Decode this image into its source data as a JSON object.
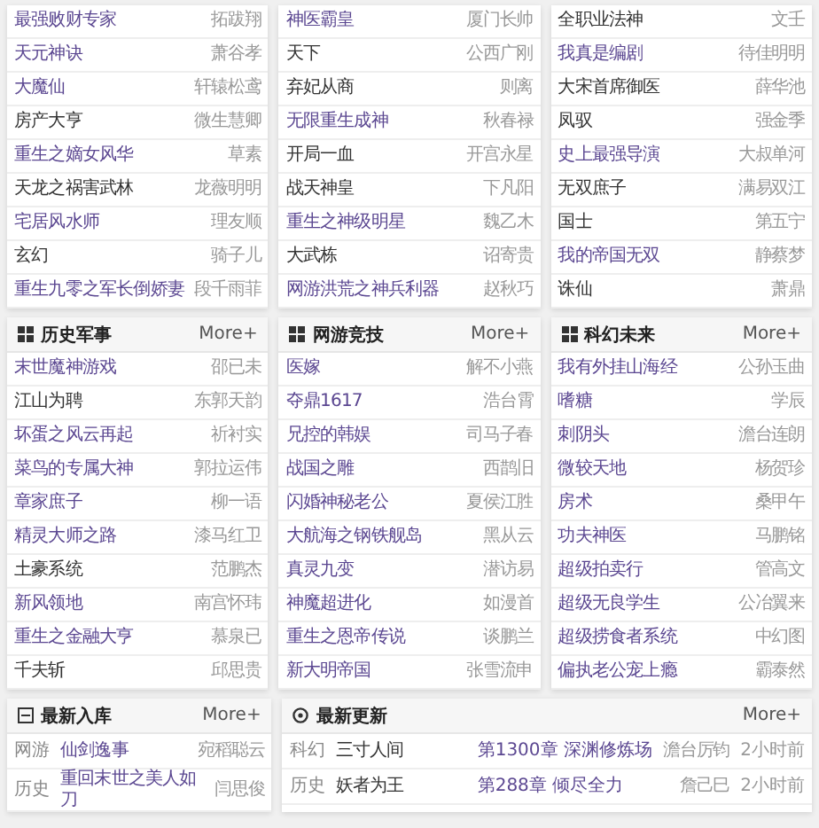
{
  "top_panels": [
    {
      "items": [
        {
          "title": "最强败财专家",
          "author": "拓跋翔",
          "visited": true
        },
        {
          "title": "天元神诀",
          "author": "萧谷孝",
          "visited": true
        },
        {
          "title": "大魔仙",
          "author": "轩辕松鸢",
          "visited": true
        },
        {
          "title": "房产大亨",
          "author": "微生慧卿",
          "visited": false
        },
        {
          "title": "重生之嫡女风华",
          "author": "草素",
          "visited": true
        },
        {
          "title": "天龙之祸害武林",
          "author": "龙薇明明",
          "visited": false
        },
        {
          "title": "宅居风水师",
          "author": "理友顺",
          "visited": true
        },
        {
          "title": "玄幻",
          "author": "骑子儿",
          "visited": false
        },
        {
          "title": "重生九零之军长倒娇妻",
          "author": "段千雨菲",
          "visited": true
        }
      ]
    },
    {
      "items": [
        {
          "title": "神医霸皇",
          "author": "厦门长帅",
          "visited": true
        },
        {
          "title": "天下",
          "author": "公西广刚",
          "visited": false
        },
        {
          "title": "弃妃从商",
          "author": "则离",
          "visited": false
        },
        {
          "title": "无限重生成神",
          "author": "秋春禄",
          "visited": true
        },
        {
          "title": "开局一血",
          "author": "开宫永星",
          "visited": false
        },
        {
          "title": "战天神皇",
          "author": "下凡阳",
          "visited": false
        },
        {
          "title": "重生之神级明星",
          "author": "魏乙木",
          "visited": true
        },
        {
          "title": "大武栋",
          "author": "诏寄贵",
          "visited": false
        },
        {
          "title": "网游洪荒之神兵利器",
          "author": "赵秋巧",
          "visited": true
        }
      ]
    },
    {
      "items": [
        {
          "title": "全职业法神",
          "author": "文壬",
          "visited": false
        },
        {
          "title": "我真是编剧",
          "author": "待佳明明",
          "visited": true
        },
        {
          "title": "大宋首席御医",
          "author": "薛华池",
          "visited": false
        },
        {
          "title": "凤驭",
          "author": "强金季",
          "visited": false
        },
        {
          "title": "史上最强导演",
          "author": "大叔单河",
          "visited": true
        },
        {
          "title": "无双庶子",
          "author": "满易双江",
          "visited": false
        },
        {
          "title": "国士",
          "author": "第五宁",
          "visited": false
        },
        {
          "title": "我的帝国无双",
          "author": "静蔡梦",
          "visited": true
        },
        {
          "title": "诛仙",
          "author": "萧鼎",
          "visited": false
        }
      ]
    }
  ],
  "category_panels": [
    {
      "title": "历史军事",
      "more": "More+",
      "items": [
        {
          "title": "末世魔神游戏",
          "author": "邵已未",
          "visited": true
        },
        {
          "title": "江山为聘",
          "author": "东郭天韵",
          "visited": false
        },
        {
          "title": "坏蛋之风云再起",
          "author": "祈衬实",
          "visited": true
        },
        {
          "title": "菜鸟的专属大神",
          "author": "郭拉运伟",
          "visited": true
        },
        {
          "title": "章家庶子",
          "author": "柳一语",
          "visited": true
        },
        {
          "title": "精灵大师之路",
          "author": "漆马红卫",
          "visited": true
        },
        {
          "title": "土豪系统",
          "author": "范鹏杰",
          "visited": false
        },
        {
          "title": "新风领地",
          "author": "南宫怀玮",
          "visited": true
        },
        {
          "title": "重生之金融大亨",
          "author": "慕泉已",
          "visited": true
        },
        {
          "title": "千夫斩",
          "author": "邱思贵",
          "visited": false
        }
      ]
    },
    {
      "title": "网游竞技",
      "more": "More+",
      "items": [
        {
          "title": "医嫁",
          "author": "解不小燕",
          "visited": true
        },
        {
          "title": "夺鼎1617",
          "author": "浩台霄",
          "visited": true
        },
        {
          "title": "兄控的韩娱",
          "author": "司马子春",
          "visited": true
        },
        {
          "title": "战国之雕",
          "author": "西鹊旧",
          "visited": true
        },
        {
          "title": "闪婚神秘老公",
          "author": "夏侯江胜",
          "visited": true
        },
        {
          "title": "大航海之钢铁舰岛",
          "author": "黑从云",
          "visited": true
        },
        {
          "title": "真灵九变",
          "author": "潜访易",
          "visited": true
        },
        {
          "title": "神魔超进化",
          "author": "如漫首",
          "visited": true
        },
        {
          "title": "重生之恩帝传说",
          "author": "谈鹏兰",
          "visited": true
        },
        {
          "title": "新大明帝国",
          "author": "张雪流申",
          "visited": true
        }
      ]
    },
    {
      "title": "科幻未来",
      "more": "More+",
      "items": [
        {
          "title": "我有外挂山海经",
          "author": "公孙玉曲",
          "visited": true
        },
        {
          "title": "嗜糖",
          "author": "学辰",
          "visited": true
        },
        {
          "title": "刺阴头",
          "author": "澹台连朗",
          "visited": true
        },
        {
          "title": "微较天地",
          "author": "杨贺珍",
          "visited": true
        },
        {
          "title": "房术",
          "author": "桑甲午",
          "visited": true
        },
        {
          "title": "功夫神医",
          "author": "马鹏铭",
          "visited": true
        },
        {
          "title": "超级拍卖行",
          "author": "管高文",
          "visited": true
        },
        {
          "title": "超级无良学生",
          "author": "公冶翼来",
          "visited": true
        },
        {
          "title": "超级捞食者系统",
          "author": "中幻图",
          "visited": true
        },
        {
          "title": "偏执老公宠上瘾",
          "author": "霸泰然",
          "visited": true
        }
      ]
    }
  ],
  "latest_added": {
    "title": "最新入库",
    "more": "More+",
    "rows": [
      {
        "category": "网游",
        "title": "仙剑逸事",
        "author": "宛稻聪云",
        "visited": true
      },
      {
        "category": "历史",
        "title": "重回末世之美人如刀",
        "author": "闫思俊",
        "visited": true
      }
    ]
  },
  "latest_updated": {
    "title": "最新更新",
    "more": "More+",
    "rows": [
      {
        "category": "科幻",
        "title": "三寸人间",
        "chapter": "第1300章 深渊修炼场",
        "author": "澹台厉钧",
        "time": "2小时前"
      },
      {
        "category": "历史",
        "title": "妖者为王",
        "chapter": "第288章 倾尽全力",
        "author": "詹己巳",
        "time": "2小时前"
      }
    ]
  }
}
